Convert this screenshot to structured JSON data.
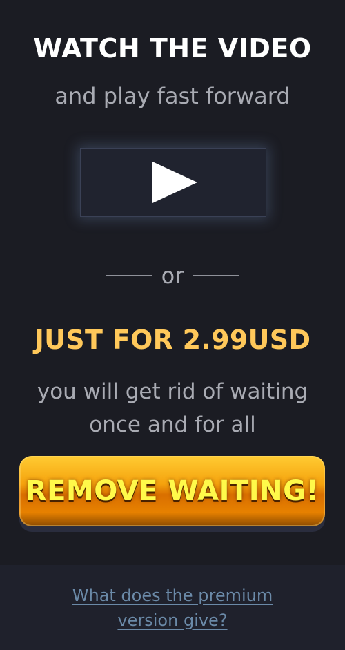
{
  "title": "WATCH THE VIDEO",
  "subtitle": "and play fast forward",
  "or_text": "or",
  "price_text": "JUST FOR 2.99USD",
  "desc_line1": "you will get rid of waiting",
  "desc_line2": "once and for all",
  "remove_button_label": "REMOVE WAITING!",
  "faq_line1": "What does the premium",
  "faq_line2": "version give?",
  "icons": {
    "play": "play-icon"
  },
  "colors": {
    "background": "#1b1c23",
    "footer_background": "#1f212c",
    "price": "#ffc85a",
    "button_orange": "#f5a20d",
    "button_text": "#fff94a",
    "link": "#6b8aa8"
  }
}
